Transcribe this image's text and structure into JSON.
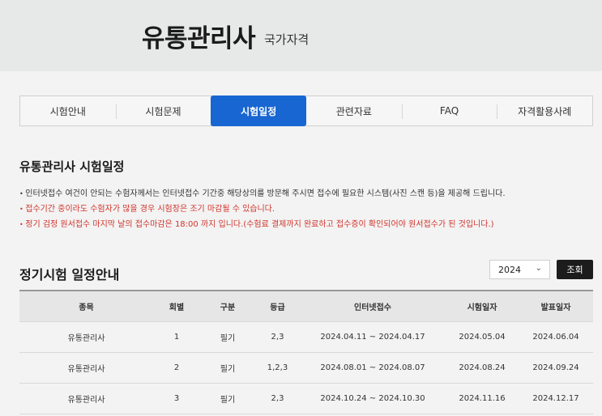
{
  "header": {
    "title": "유통관리사",
    "subtitle": "국가자격"
  },
  "tabs": [
    {
      "label": "시험안내"
    },
    {
      "label": "시험문제"
    },
    {
      "label": "시험일정",
      "active": true
    },
    {
      "label": "관련자료"
    },
    {
      "label": "FAQ"
    },
    {
      "label": "자격활용사례"
    }
  ],
  "section": {
    "title": "유통관리사 시험일정",
    "notes": [
      "인터넷접수 여건이 안되는 수험자께서는 인터넷접수 기간중 해당상의를 방문해 주시면 접수에 필요한 시스템(사진 스캔 등)을 제공해 드립니다.",
      "접수기간 중이라도 수험자가 많을 경우 시험장은 조기 마감될 수 있습니다.",
      "정기 검정 원서접수 마지막 날의 접수마감은 18:00 까지 입니다.(수험료 결제까지 완료하고 접수증이 확인되어야 원서접수가 된 것입니다.)"
    ]
  },
  "schedule": {
    "title": "정기시험 일정안내",
    "year_selected": "2024",
    "search_label": "조회",
    "columns": [
      "종목",
      "회별",
      "구분",
      "등급",
      "인터넷접수",
      "시험일자",
      "발표일자"
    ],
    "rows": [
      [
        "유통관리사",
        "1",
        "필기",
        "2,3",
        "2024.04.11 ~ 2024.04.17",
        "2024.05.04",
        "2024.06.04"
      ],
      [
        "유통관리사",
        "2",
        "필기",
        "1,2,3",
        "2024.08.01 ~ 2024.08.07",
        "2024.08.24",
        "2024.09.24"
      ],
      [
        "유통관리사",
        "3",
        "필기",
        "2,3",
        "2024.10.24 ~ 2024.10.30",
        "2024.11.16",
        "2024.12.17"
      ]
    ]
  },
  "colors": {
    "accent": "#1766d1",
    "notice_red": "#d0332b",
    "button_dark": "#1c1c1c"
  }
}
